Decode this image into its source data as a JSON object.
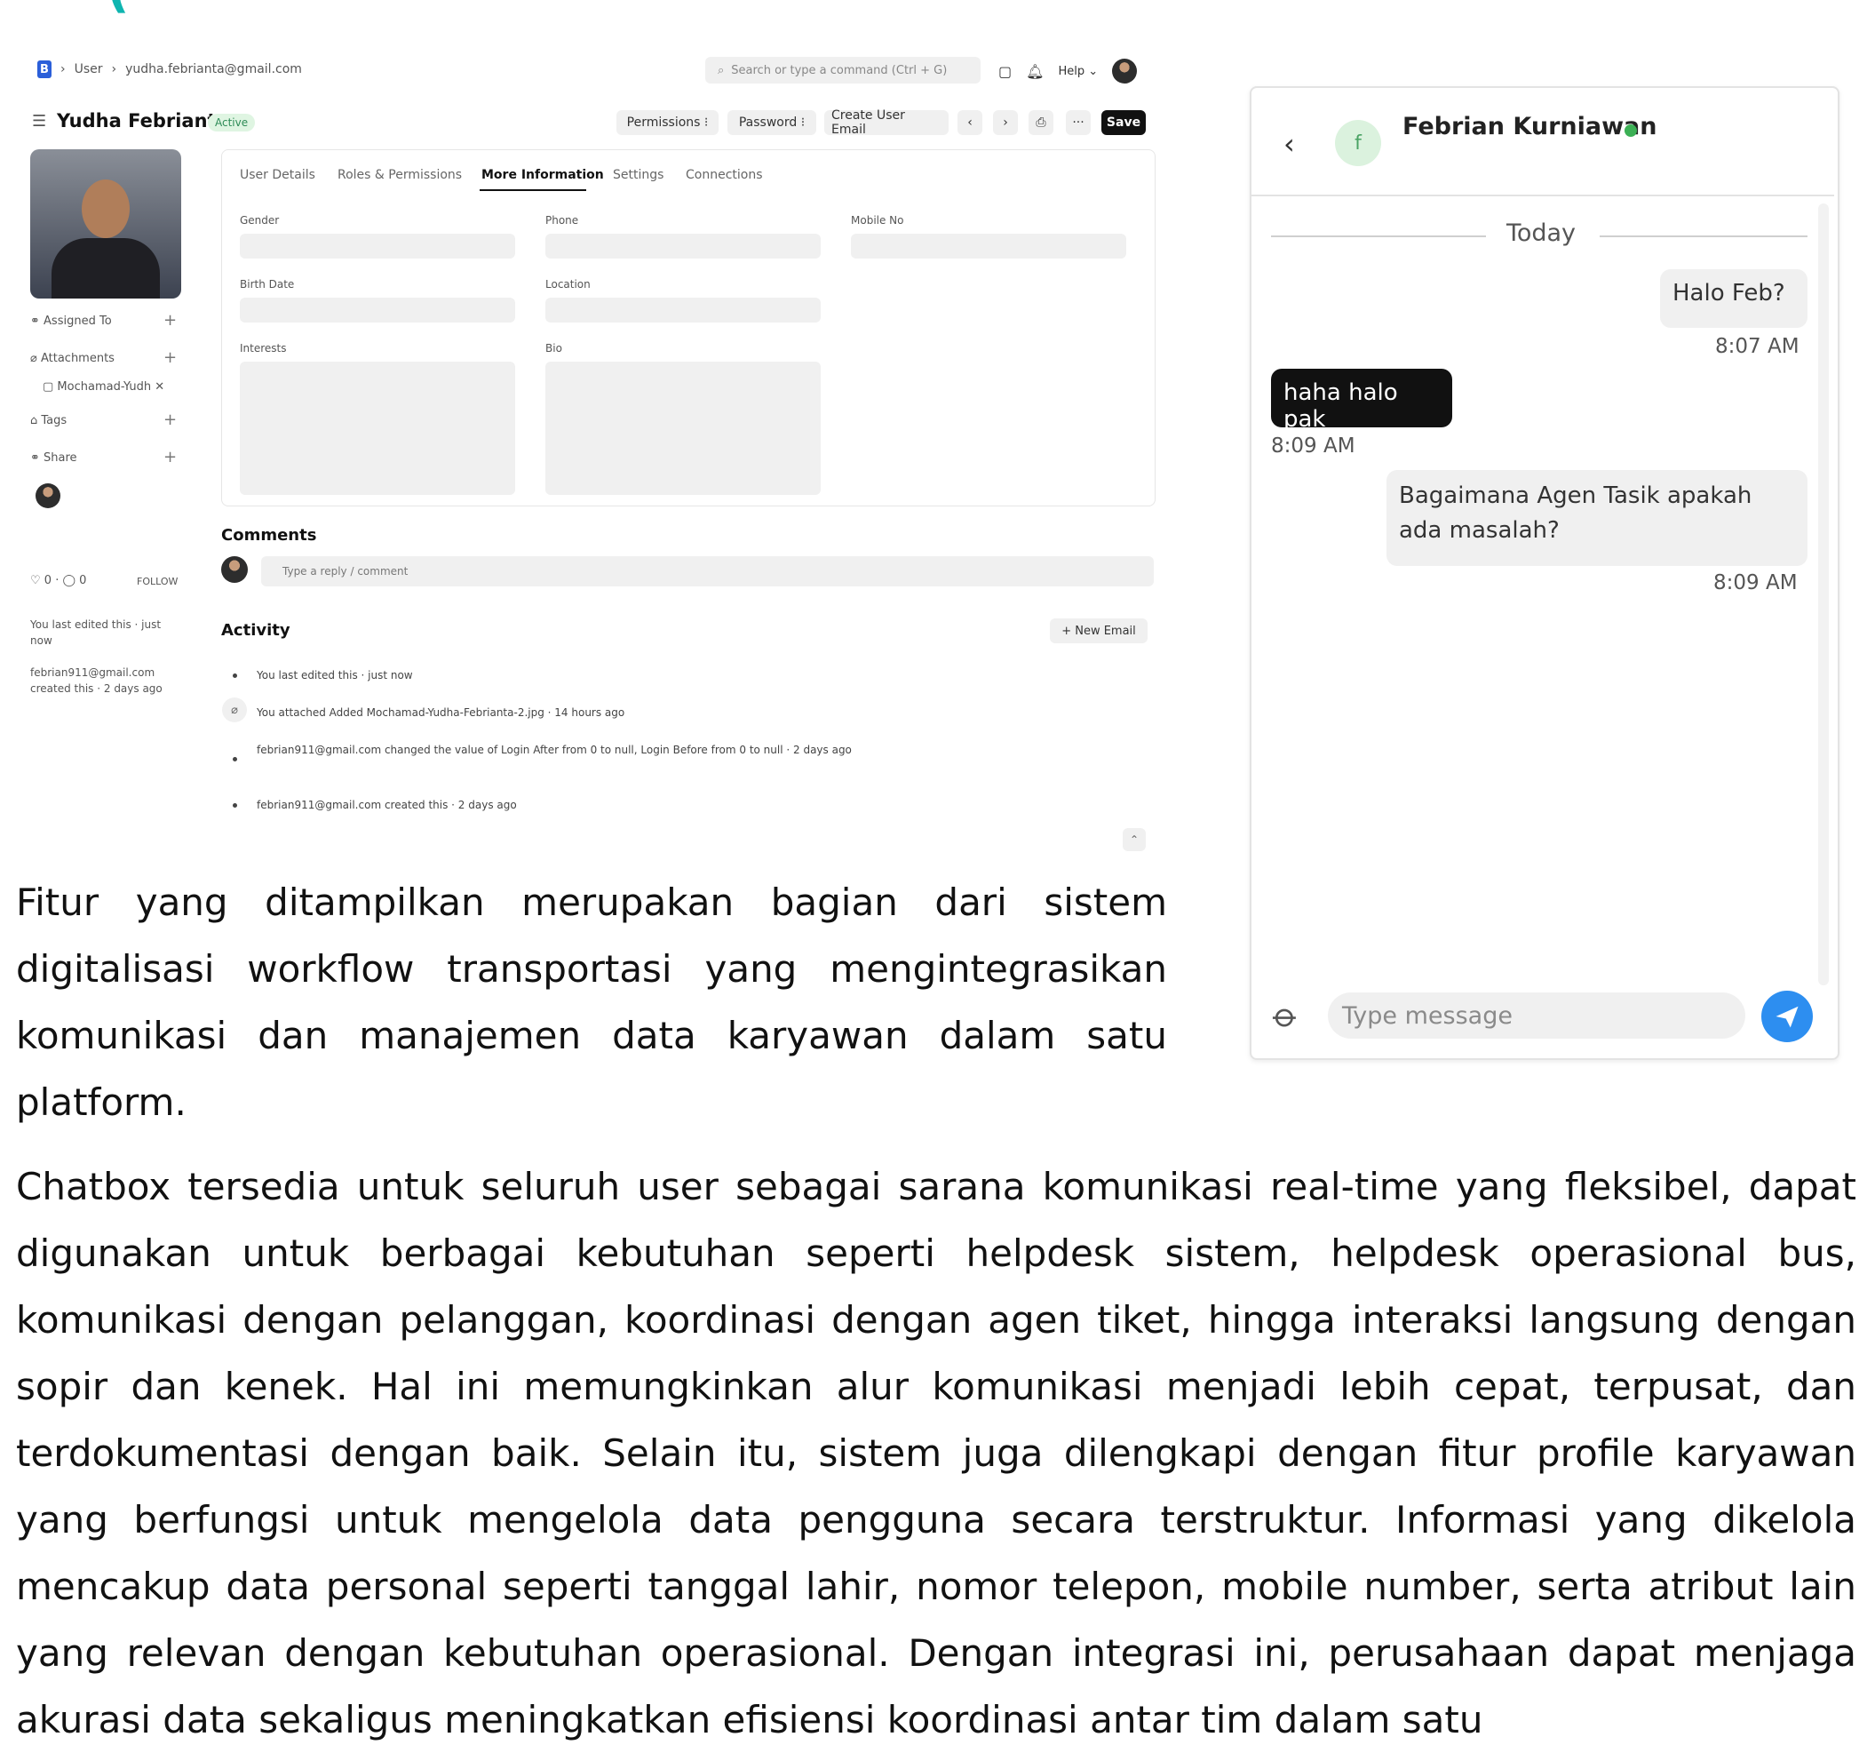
{
  "heading": "(",
  "admin": {
    "breadcrumb": [
      "User",
      "yudha.febrianta@gmail.com"
    ],
    "search_placeholder": "Search or type a command (Ctrl + G)",
    "help_label": "Help",
    "user_name": "Yudha Febrianta",
    "status": "Active",
    "toolbar": {
      "permissions": "Permissions",
      "password": "Password",
      "create_user_email": "Create User Email",
      "save": "Save"
    },
    "sidebar": {
      "assigned_to": "Assigned To",
      "attachments": "Attachments",
      "attachment_file": "Mochamad-Yudh",
      "tags": "Tags",
      "share": "Share",
      "likes": "0",
      "comments_count": "0",
      "follow": "FOLLOW",
      "last_edited": "You last edited this · just now",
      "created_by": "febrian911@gmail.com created this · 2 days ago"
    },
    "tabs": [
      "User Details",
      "Roles & Permissions",
      "More Information",
      "Settings",
      "Connections"
    ],
    "fields": {
      "gender": "Gender",
      "phone": "Phone",
      "mobile_no": "Mobile No",
      "birth_date": "Birth Date",
      "location": "Location",
      "interests": "Interests",
      "bio": "Bio"
    },
    "comments_title": "Comments",
    "comment_placeholder": "Type a reply / comment",
    "activity_title": "Activity",
    "new_email": "+ New Email",
    "activity": [
      "You last edited this · just now",
      "You attached Added Mochamad-Yudha-Febrianta-2.jpg · 14 hours ago",
      "febrian911@gmail.com changed the value of Login After from 0 to null, Login Before from 0 to null · 2 days ago",
      "febrian911@gmail.com created this · 2 days ago"
    ]
  },
  "chat": {
    "contact_initial": "f",
    "contact_name": "Febrian Kurniawan",
    "date_divider": "Today",
    "messages": [
      {
        "text": "Halo Feb?",
        "time": "8:07 AM",
        "side": "right"
      },
      {
        "text": "haha halo pak",
        "time": "8:09 AM",
        "side": "left"
      },
      {
        "text": "Bagaimana Agen Tasik apakah ada masalah?",
        "time": "8:09 AM",
        "side": "right"
      }
    ],
    "input_placeholder": "Type message"
  },
  "paragraphs": [
    "Fitur yang ditampilkan merupakan bagian dari sistem digitalisasi workflow transportasi yang mengintegrasikan komunikasi dan manajemen data karyawan dalam satu platform.",
    "Chatbox tersedia untuk seluruh user sebagai sarana komunikasi real-time yang fleksibel, dapat digunakan untuk berbagai kebutuhan seperti helpdesk sistem, helpdesk operasional bus, komunikasi dengan pelanggan, koordinasi dengan agen tiket, hingga interaksi langsung dengan sopir dan kenek. Hal ini memungkinkan alur komunikasi menjadi lebih cepat, terpusat, dan terdokumentasi dengan baik. Selain itu, sistem juga dilengkapi dengan fitur profile karyawan yang berfungsi untuk mengelola data pengguna secara terstruktur. Informasi yang dikelola mencakup data personal seperti tanggal lahir, nomor telepon, mobile number, serta atribut lain yang relevan dengan kebutuhan operasional. Dengan integrasi ini, perusahaan dapat menjaga akurasi data sekaligus meningkatkan efisiensi koordinasi antar tim dalam satu"
  ]
}
